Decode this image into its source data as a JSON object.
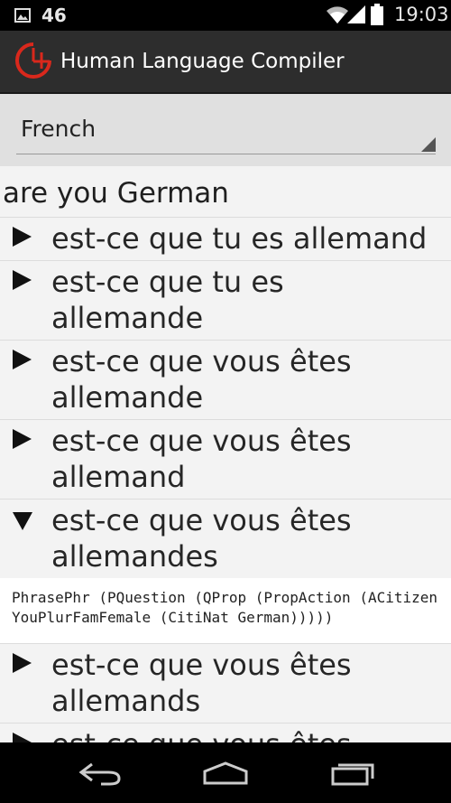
{
  "status_bar": {
    "notification_icon": "image-icon",
    "notification_count": "46",
    "time": "19:03"
  },
  "app": {
    "title": "Human Language Compiler",
    "icon": "clock-logo-icon",
    "accent_color": "#d9281c"
  },
  "language_spinner": {
    "selected": "French"
  },
  "source_phrase": "are you German",
  "translations": [
    {
      "text": "est-ce que tu es allemand",
      "expanded": false
    },
    {
      "text": "est-ce que tu es allemande",
      "expanded": false
    },
    {
      "text": "est-ce que vous êtes allemande",
      "expanded": false
    },
    {
      "text": "est-ce que vous êtes allemand",
      "expanded": false
    },
    {
      "text": "est-ce que vous êtes allemandes",
      "expanded": true,
      "tree": "PhrasePhr (PQuestion (QProp (PropAction (ACitizen YouPlurFamFemale (CitiNat German)))))"
    },
    {
      "text": "est-ce que vous êtes allemands",
      "expanded": false
    },
    {
      "text": "est-ce que vous êtes",
      "expanded": false
    }
  ],
  "nav_bar": {
    "back": "back-icon",
    "home": "home-icon",
    "recents": "recents-icon"
  }
}
